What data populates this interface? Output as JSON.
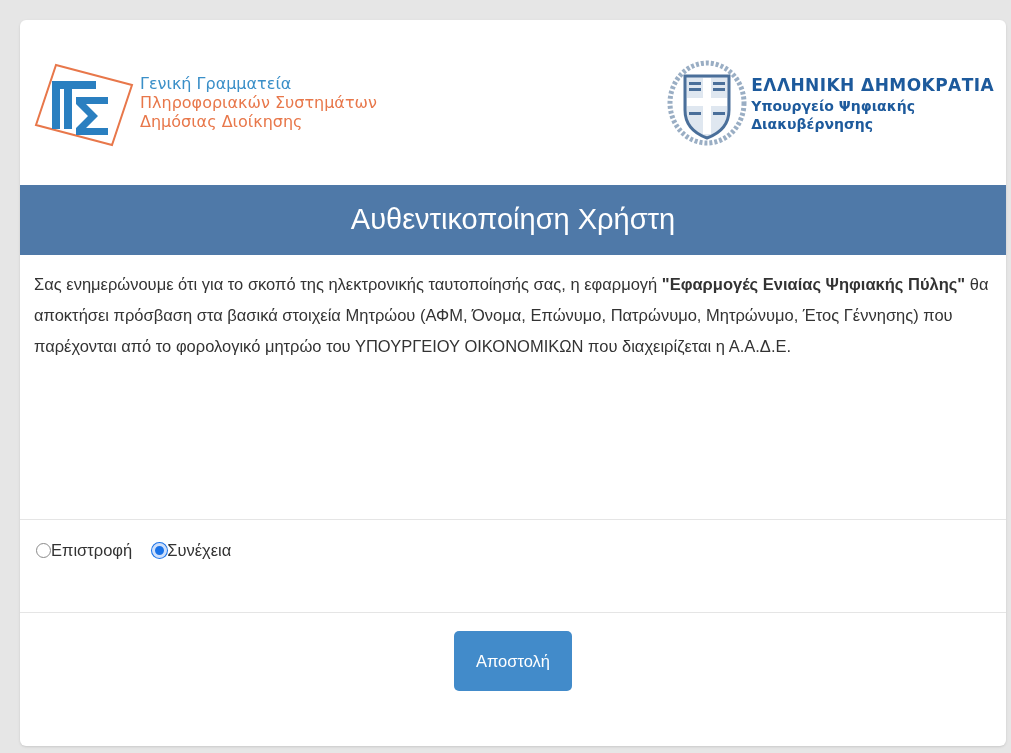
{
  "header": {
    "left_logo": {
      "lines": [
        {
          "text": "Γενική Γραμματεία",
          "color": "#3a8fc8"
        },
        {
          "text": "Πληροφοριακών Συστημάτων",
          "color": "#e8774a"
        },
        {
          "text": "Δημόσιας Διοίκησης",
          "color": "#e8774a"
        }
      ]
    },
    "right_logo": {
      "title": "ΕΛΛΗΝΙΚΗ ΔΗΜΟΚΡΑΤΙΑ",
      "lines": [
        "Υπουργείο Ψηφιακής",
        "Διακυβέρνησης"
      ]
    }
  },
  "banner": {
    "title": "Αυθεντικοποίηση Χρήστη"
  },
  "message": "Σας ενημερώνουμε ότι για το σκοπό της ηλεκτρονικής ταυτοποίησής σας, η εφαρμογή **\"Εφαρμογές Ενιαίας Ψηφιακής Πύλης\"** θα αποκτήσει πρόσβαση στα βασικά στοιχεία Μητρώου (ΑΦΜ, Όνομα, Επώνυμο, Πατρώνυμο, Μητρώνυμο, Έτος Γέννησης) που παρέχονται από το φορολογικό μητρώο του ΥΠΟΥΡΓΕΙΟΥ ΟΙΚΟΝΟΜΙΚΩΝ που διαχειρίζεται η Α.Α.Δ.Ε.",
  "options": [
    {
      "label": "Επιστροφή",
      "selected": false
    },
    {
      "label": "Συνέχεια",
      "selected": true
    }
  ],
  "submit_button": "Αποστολή"
}
